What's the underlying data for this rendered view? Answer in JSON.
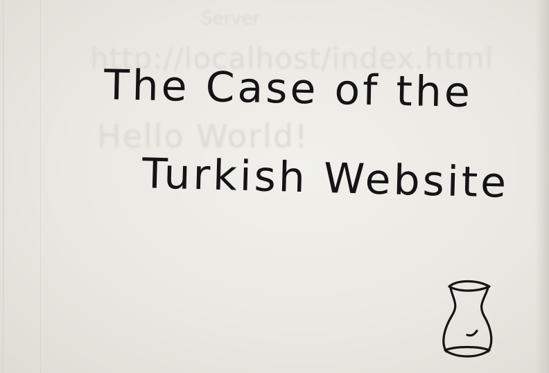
{
  "title": {
    "line1": "The Case of the",
    "line2": "Turkish Website"
  },
  "show_through": {
    "line1": "Server",
    "line2": "http://localhost/index.html",
    "line3": "Hello World!"
  },
  "colors": {
    "paper": "#e9e8e2",
    "ink": "#141414"
  },
  "icons": {
    "drawing": "turkish-tea-glass-icon"
  }
}
